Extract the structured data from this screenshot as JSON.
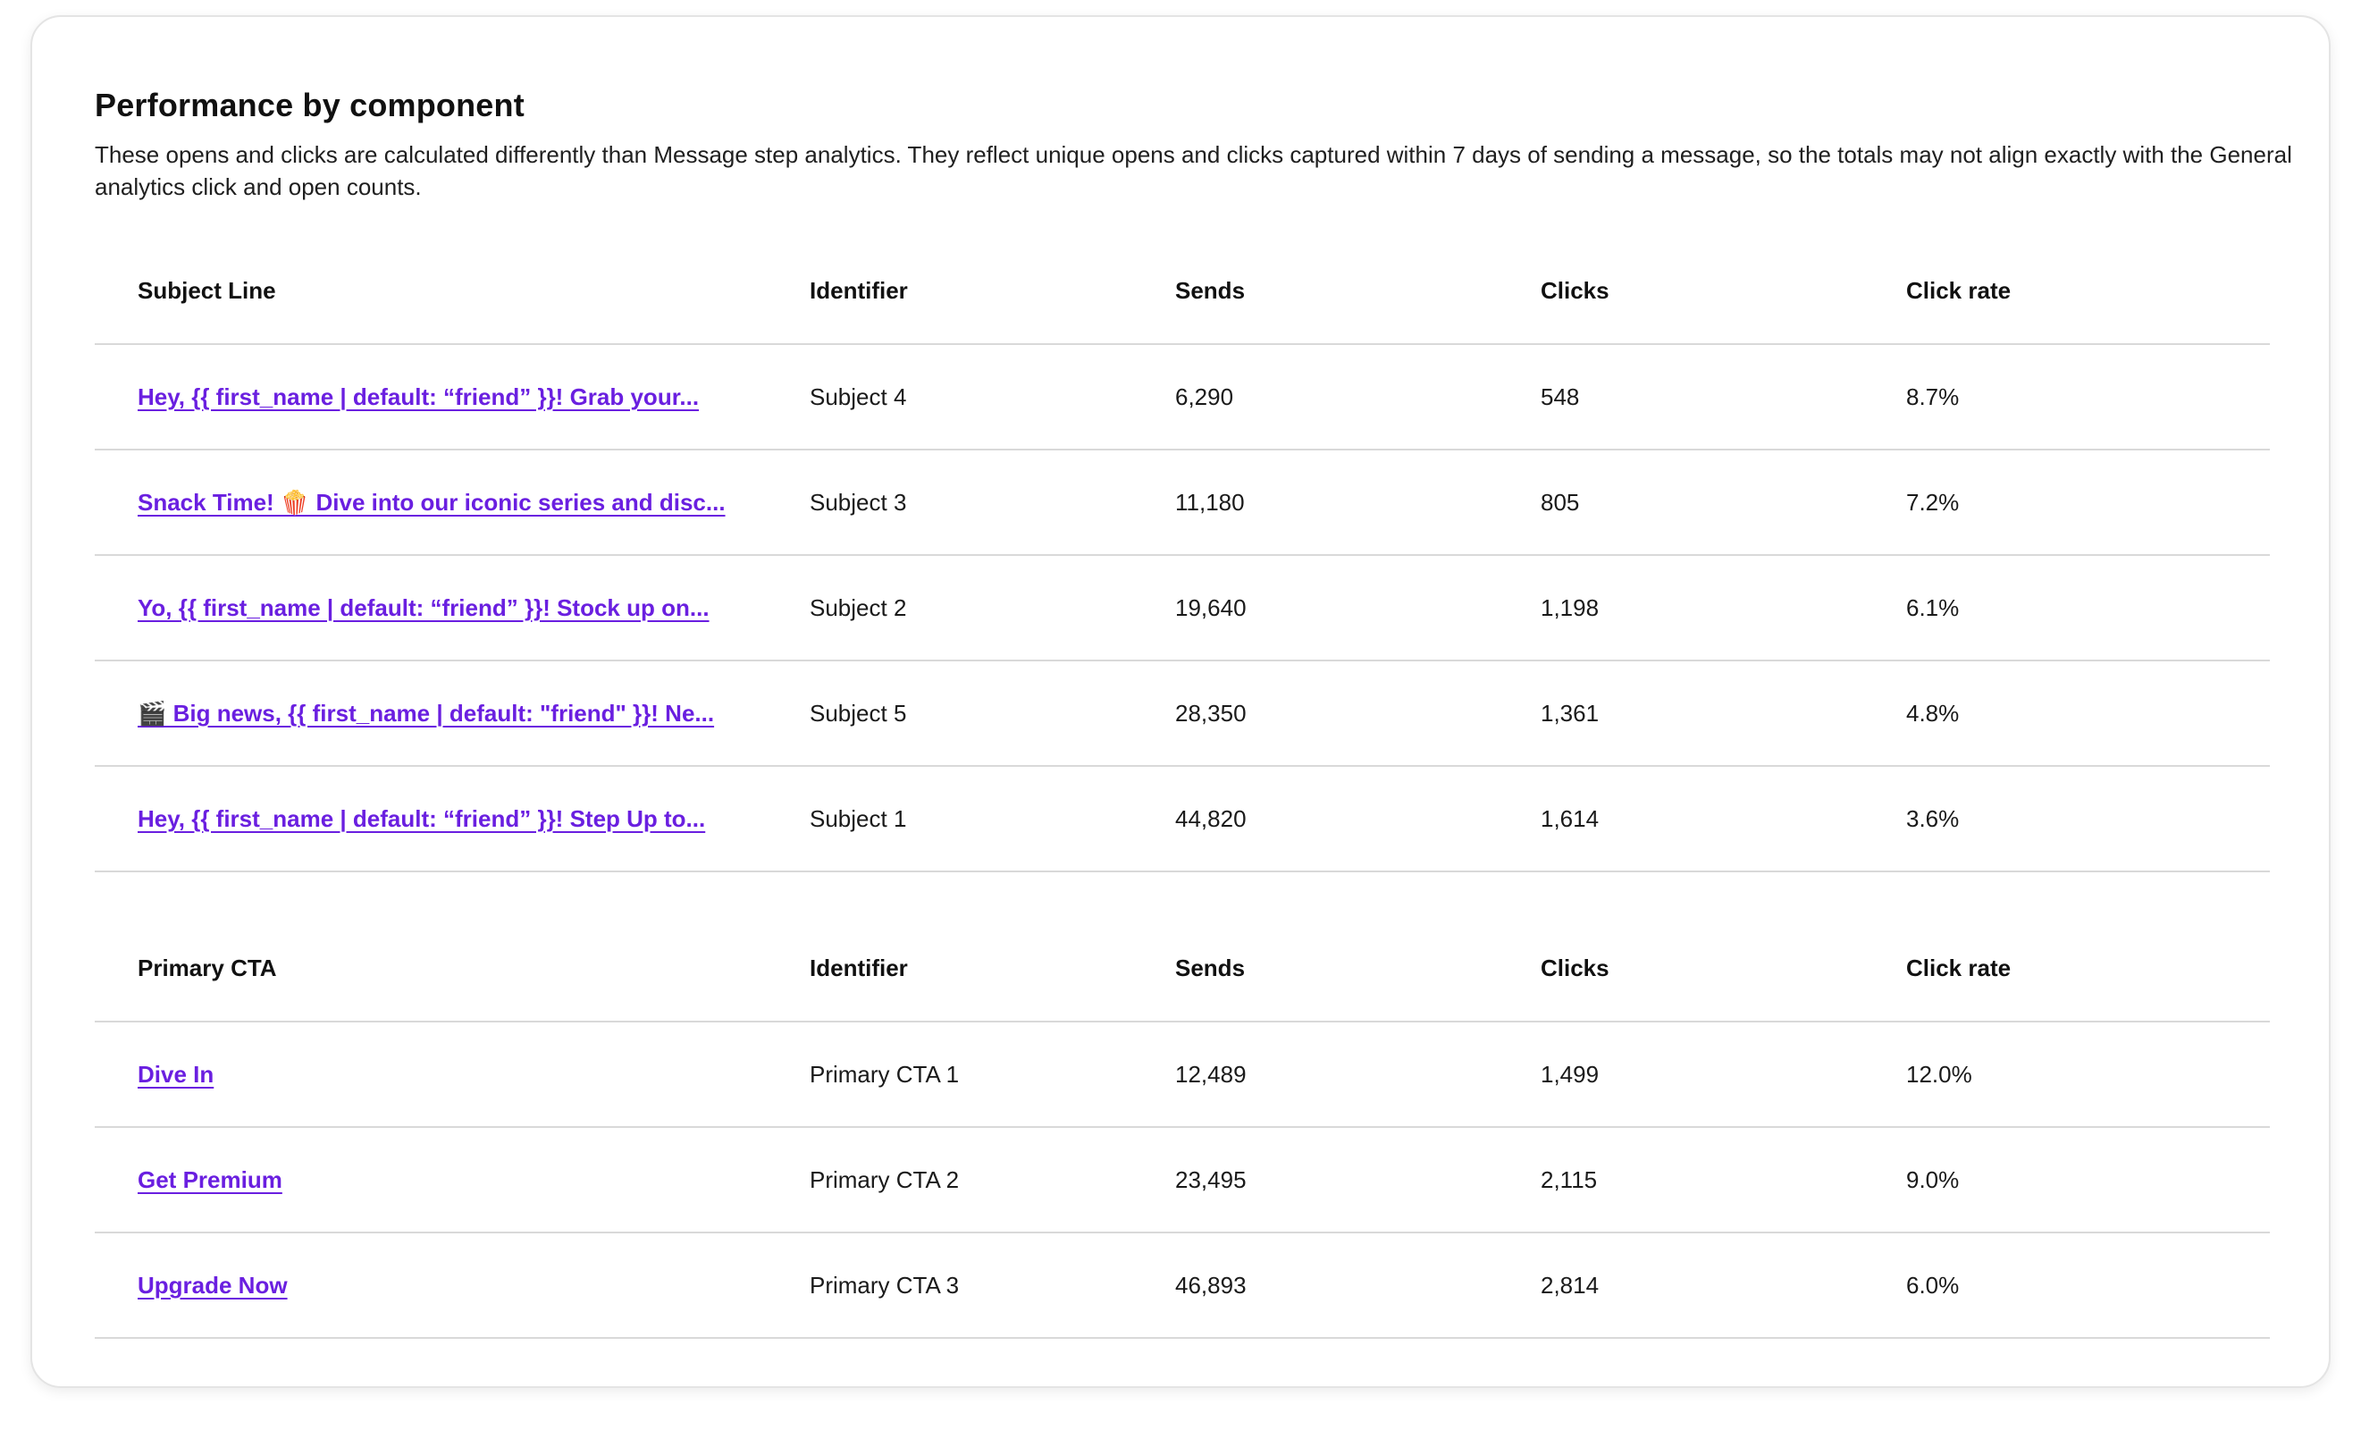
{
  "header": {
    "title": "Performance by component",
    "description": "These opens and clicks are calculated differently than Message step analytics. They reflect unique opens and clicks captured within 7 days of sending a message, so the totals may not align exactly with the General analytics click and open counts."
  },
  "subject_table": {
    "columns": [
      "Subject Line",
      "Identifier",
      "Sends",
      "Clicks",
      "Click rate"
    ],
    "rows": [
      {
        "name": "Hey, {{ first_name | default: “friend” }}! Grab your...",
        "identifier": "Subject 4",
        "sends": "6,290",
        "clicks": "548",
        "click_rate": "8.7%"
      },
      {
        "name": "Snack Time! 🍿 Dive into our iconic series and disc...",
        "identifier": "Subject 3",
        "sends": "11,180",
        "clicks": "805",
        "click_rate": "7.2%"
      },
      {
        "name": "Yo, {{ first_name | default: “friend” }}! Stock up on...",
        "identifier": "Subject 2",
        "sends": "19,640",
        "clicks": "1,198",
        "click_rate": "6.1%"
      },
      {
        "name": "🎬 Big news, {{ first_name | default: \"friend\" }}! Ne...",
        "identifier": "Subject 5",
        "sends": "28,350",
        "clicks": "1,361",
        "click_rate": "4.8%"
      },
      {
        "name": "Hey, {{ first_name | default: “friend” }}! Step Up to...",
        "identifier": "Subject 1",
        "sends": "44,820",
        "clicks": "1,614",
        "click_rate": "3.6%"
      }
    ]
  },
  "cta_table": {
    "columns": [
      "Primary CTA",
      "Identifier",
      "Sends",
      "Clicks",
      "Click rate"
    ],
    "rows": [
      {
        "name": "Dive In",
        "identifier": "Primary CTA 1",
        "sends": "12,489",
        "clicks": "1,499",
        "click_rate": "12.0%"
      },
      {
        "name": "Get Premium",
        "identifier": "Primary CTA 2",
        "sends": "23,495",
        "clicks": "2,115",
        "click_rate": "9.0%"
      },
      {
        "name": "Upgrade Now",
        "identifier": "Primary CTA 3",
        "sends": "46,893",
        "clicks": "2,814",
        "click_rate": "6.0%"
      }
    ]
  },
  "colors": {
    "link": "#6a1fe0",
    "divider": "#d9d9d9",
    "card_border": "#e4e4e4"
  }
}
